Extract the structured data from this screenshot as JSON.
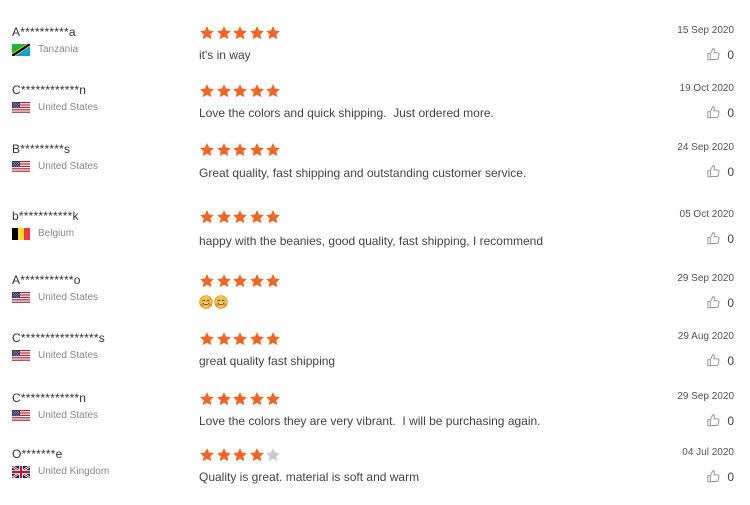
{
  "colors": {
    "star_filled": "#f26522",
    "star_empty": "#c8c8d0",
    "text": "#444444",
    "muted": "#888888"
  },
  "icons": {
    "rating": "star-icon",
    "like": "thumbs-up-icon",
    "emoji": "smiling-face-emoji"
  },
  "reviews": [
    {
      "name": "A**********a",
      "country": "Tanzania",
      "flag": "tz",
      "rating": 5,
      "text": "it's in way",
      "date": "15 Sep 2020",
      "likes": "0"
    },
    {
      "name": "C************n",
      "country": "United States",
      "flag": "us",
      "rating": 5,
      "text": "Love the colors and quick shipping.  Just ordered more.",
      "date": "19 Oct 2020",
      "likes": "0"
    },
    {
      "name": "B*********s",
      "country": "United States",
      "flag": "us",
      "rating": 5,
      "text": "Great quality, fast shipping and outstanding customer service.",
      "date": "24 Sep 2020",
      "likes": "0"
    },
    {
      "name": "b***********k",
      "country": "Belgium",
      "flag": "be",
      "rating": 5,
      "text": "happy with the beanies, good quality, fast shipping, I recommend",
      "date": "05 Oct 2020",
      "likes": "0"
    },
    {
      "name": "A***********o",
      "country": "United States",
      "flag": "us",
      "rating": 5,
      "text": "",
      "emoji_count": 2,
      "date": "29 Sep 2020",
      "likes": "0"
    },
    {
      "name": "C****************s",
      "country": "United States",
      "flag": "us",
      "rating": 5,
      "text": "great quality fast shipping",
      "date": "29 Aug 2020",
      "likes": "0"
    },
    {
      "name": "C************n",
      "country": "United States",
      "flag": "us",
      "rating": 5,
      "text": "Love the colors they are very vibrant.  I will be purchasing again.",
      "date": "29 Sep 2020",
      "likes": "0"
    },
    {
      "name": "O*******e",
      "country": "United Kingdom",
      "flag": "gb",
      "rating": 4,
      "text": "Quality is great. material is soft and warm",
      "date": "04 Jul 2020",
      "likes": "0"
    }
  ]
}
